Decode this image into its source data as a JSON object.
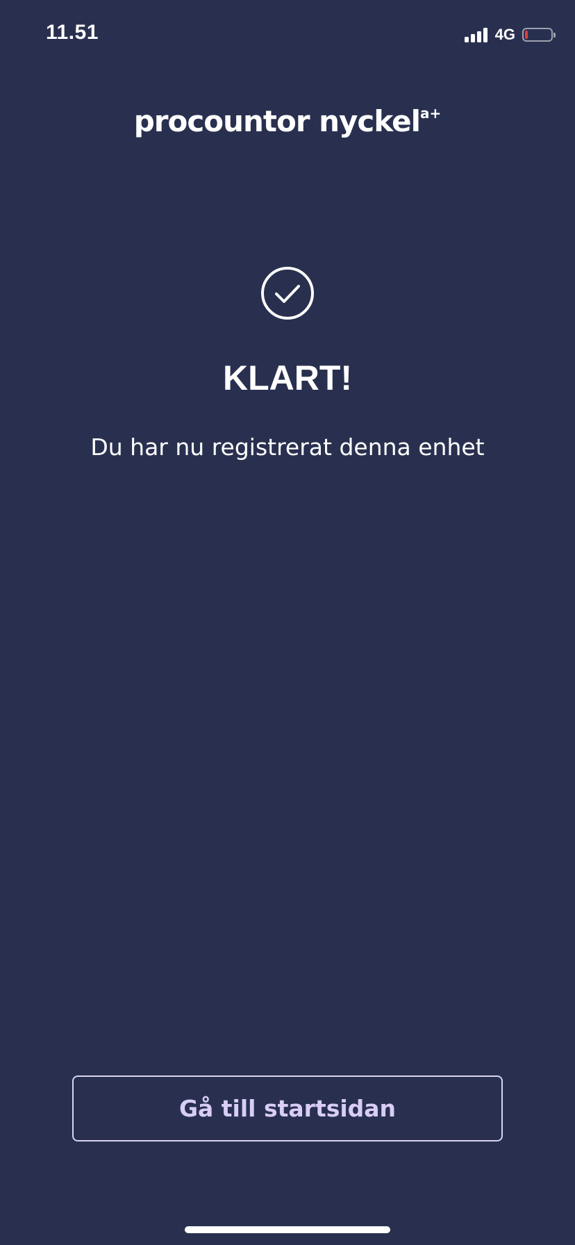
{
  "status_bar": {
    "time": "11.51",
    "network": "4G",
    "icons": [
      "signal-icon",
      "battery-low-icon"
    ],
    "battery_color": "#e23b3b"
  },
  "logo": {
    "text": "procountor nyckel",
    "superscript": "a+"
  },
  "confirmation": {
    "icon": "check-circle-icon",
    "title": "KLART!",
    "message": "Du har nu registrerat denna enhet"
  },
  "actions": {
    "home_button_label": "Gå till startsidan"
  },
  "colors": {
    "background": "#29304f",
    "button_text": "#d8cdf7",
    "button_border": "#d9d4ef"
  }
}
